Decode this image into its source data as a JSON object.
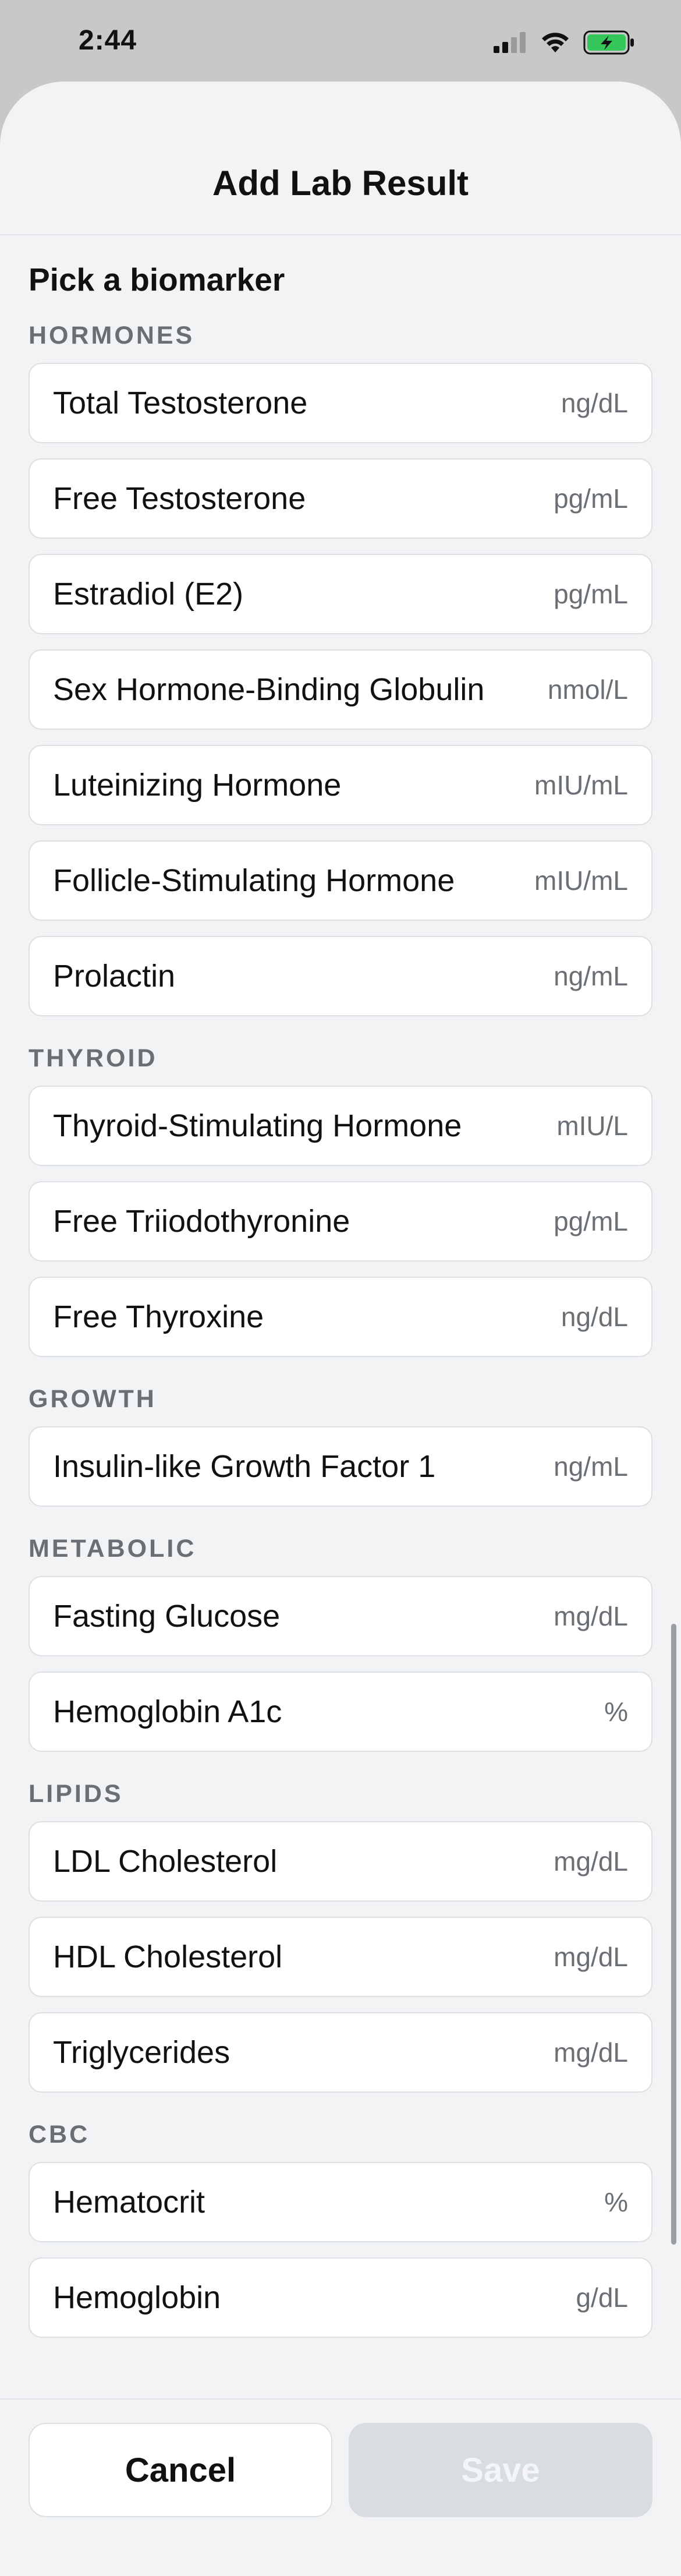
{
  "status_bar": {
    "time": "2:44"
  },
  "sheet": {
    "title": "Add Lab Result",
    "pick_label": "Pick a biomarker"
  },
  "groups": [
    {
      "label": "HORMONES",
      "items": [
        {
          "name": "Total Testosterone",
          "unit": "ng/dL"
        },
        {
          "name": "Free Testosterone",
          "unit": "pg/mL"
        },
        {
          "name": "Estradiol (E2)",
          "unit": "pg/mL"
        },
        {
          "name": "Sex Hormone-Binding Globulin",
          "unit": "nmol/L"
        },
        {
          "name": "Luteinizing Hormone",
          "unit": "mIU/mL"
        },
        {
          "name": "Follicle-Stimulating Hormone",
          "unit": "mIU/mL"
        },
        {
          "name": "Prolactin",
          "unit": "ng/mL"
        }
      ]
    },
    {
      "label": "THYROID",
      "items": [
        {
          "name": "Thyroid-Stimulating Hormone",
          "unit": "mIU/L"
        },
        {
          "name": "Free Triiodothyronine",
          "unit": "pg/mL"
        },
        {
          "name": "Free Thyroxine",
          "unit": "ng/dL"
        }
      ]
    },
    {
      "label": "GROWTH",
      "items": [
        {
          "name": "Insulin-like Growth Factor 1",
          "unit": "ng/mL"
        }
      ]
    },
    {
      "label": "METABOLIC",
      "items": [
        {
          "name": "Fasting Glucose",
          "unit": "mg/dL"
        },
        {
          "name": "Hemoglobin A1c",
          "unit": "%"
        }
      ]
    },
    {
      "label": "LIPIDS",
      "items": [
        {
          "name": "LDL Cholesterol",
          "unit": "mg/dL"
        },
        {
          "name": "HDL Cholesterol",
          "unit": "mg/dL"
        },
        {
          "name": "Triglycerides",
          "unit": "mg/dL"
        }
      ]
    },
    {
      "label": "CBC",
      "items": [
        {
          "name": "Hematocrit",
          "unit": "%"
        },
        {
          "name": "Hemoglobin",
          "unit": "g/dL"
        }
      ]
    }
  ],
  "footer": {
    "cancel_label": "Cancel",
    "save_label": "Save"
  },
  "icons": {
    "signal": "cellular-signal-icon",
    "wifi": "wifi-icon",
    "battery": "battery-charging-icon"
  },
  "colors": {
    "sheet_background": "#f2f3f5",
    "card_background": "#ffffff",
    "section_label": "#6a6f75",
    "save_disabled": "#d9dce0",
    "battery_fill": "#35c759"
  }
}
